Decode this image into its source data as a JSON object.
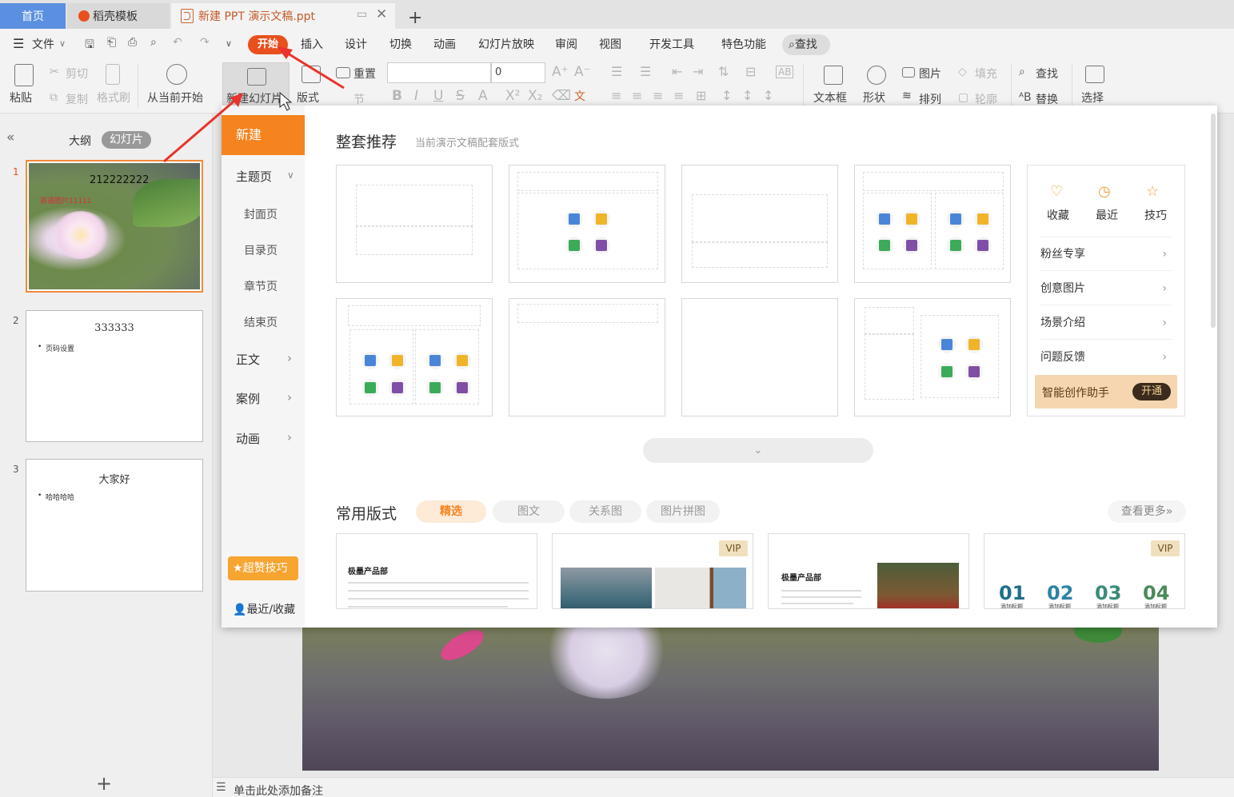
{
  "tabs": {
    "home": "首页",
    "templates": "稻壳模板",
    "document": "新建 PPT 演示文稿.ppt",
    "add": "+"
  },
  "menu": {
    "file": "文件",
    "items": [
      "开始",
      "插入",
      "设计",
      "切换",
      "动画",
      "幻灯片放映",
      "审阅",
      "视图",
      "开发工具",
      "特色功能"
    ],
    "search": "查找"
  },
  "ribbon": {
    "paste": "粘贴",
    "cut": "剪切",
    "copy": "复制",
    "format_painter": "格式刷",
    "from_current": "从当前开始",
    "new_slide": "新建幻灯片",
    "layout": "版式",
    "reset": "重置",
    "section": "节",
    "font_size": "0",
    "text_box": "文本框",
    "shape": "形状",
    "picture": "图片",
    "arrange": "排列",
    "fill": "填充",
    "outline": "轮廓",
    "find": "查找",
    "replace": "替换",
    "select": "选择"
  },
  "panel": {
    "outline": "大纲",
    "slides": "幻灯片",
    "add": "+"
  },
  "slides": [
    {
      "num": "1",
      "title": "212222222",
      "sub": "普通图片11111"
    },
    {
      "num": "2",
      "title": "333333",
      "bullet": "页码设置"
    },
    {
      "num": "3",
      "title": "大家好",
      "bullet": "哈哈哈哈"
    }
  ],
  "notes": "单击此处添加备注",
  "dropdown": {
    "nav": {
      "new": "新建",
      "theme": "主题页",
      "cover": "封面页",
      "toc": "目录页",
      "chapter": "章节页",
      "end": "结束页",
      "body": "正文",
      "case": "案例",
      "anim": "动画",
      "tips_btn": "超赞技巧",
      "recent": "最近/收藏"
    },
    "section_title": "整套推荐",
    "section_sub": "当前演示文稿配套版式",
    "right": {
      "fav": "收藏",
      "recent": "最近",
      "skill": "技巧",
      "rows": [
        "粉丝专享",
        "创意图片",
        "场景介绍",
        "问题反馈"
      ],
      "assistant": "智能创作助手",
      "open": "开通"
    },
    "common": {
      "title": "常用版式",
      "filters": [
        "精选",
        "图文",
        "关系图",
        "图片拼图"
      ],
      "more": "查看更多"
    },
    "layouts": [
      {
        "heading": "极墨产品部",
        "vip": ""
      },
      {
        "heading": "",
        "vip": "VIP"
      },
      {
        "heading": "极墨产品部",
        "vip": ""
      },
      {
        "heading": "",
        "vip": "VIP",
        "nums": [
          "01",
          "02",
          "03",
          "04"
        ],
        "caption": "添加标题"
      }
    ]
  },
  "colors": {
    "accent": "#f5831f",
    "start": "#e8501e",
    "tab_home": "#5b8fe0"
  }
}
